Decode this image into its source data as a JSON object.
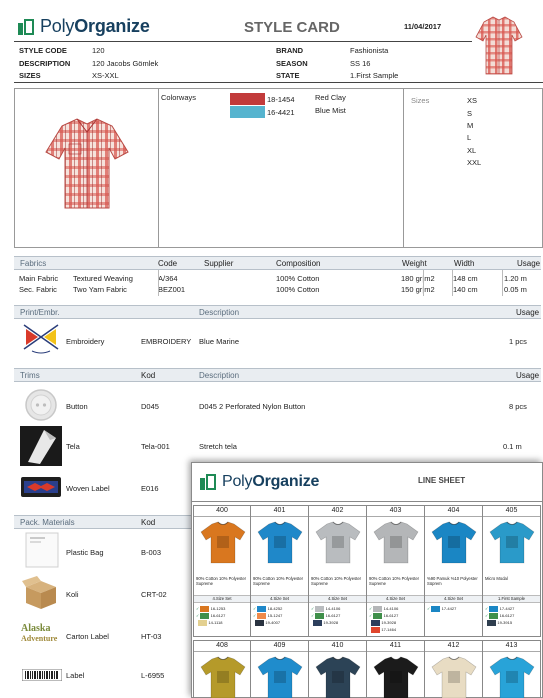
{
  "style_card": {
    "brand_light": "Poly",
    "brand_bold": "Organize",
    "title": "STYLE CARD",
    "date": "11/04/2017",
    "fields_left": [
      {
        "label": "STYLE CODE",
        "value": "120"
      },
      {
        "label": "DESCRIPTION",
        "value": "120 Jacobs Gömlek"
      },
      {
        "label": "SIZES",
        "value": "XS-XXL"
      }
    ],
    "fields_right": [
      {
        "label": "BRAND",
        "value": "Fashionista"
      },
      {
        "label": "SEASON",
        "value": "SS 16"
      },
      {
        "label": "STATE",
        "value": "1.First Sample"
      }
    ],
    "colorways_label": "Colorways",
    "colorways": [
      {
        "code": "18-1454",
        "name": "Red Clay",
        "color": "#c23b3b"
      },
      {
        "code": "16-4421",
        "name": "Blue Mist",
        "color": "#56b4cf"
      }
    ],
    "sizes_label": "Sizes",
    "sizes": [
      "XS",
      "S",
      "M",
      "L",
      "XL",
      "XXL"
    ],
    "fabrics": {
      "headers": [
        "Fabrics",
        "Code",
        "Supplier",
        "Composition",
        "Weight",
        "Width",
        "Usage"
      ],
      "rows": [
        {
          "type": "Main Fabric",
          "name": "Textured Weaving",
          "code": "A/364",
          "supplier": "",
          "composition": "100% Cotton",
          "weight": "180 gr|m2",
          "width": "148 cm",
          "usage": "1.20 m"
        },
        {
          "type": "Sec. Fabric",
          "name": "Two Yarn Fabric",
          "code": "BEZ001",
          "supplier": "",
          "composition": "100% Cotton",
          "weight": "150 gr|m2",
          "width": "140 cm",
          "usage": "0.05 m"
        }
      ]
    },
    "print": {
      "headers": [
        "Print/Embr.",
        "Description",
        "Usage"
      ],
      "rows": [
        {
          "name": "Embroidery",
          "code": "EMBROIDERY",
          "description": "Blue Marine",
          "usage": "1  pcs"
        }
      ]
    },
    "trims": {
      "headers": [
        "Trims",
        "Kod",
        "Description",
        "Usage"
      ],
      "rows": [
        {
          "name": "Button",
          "code": "D045",
          "description": "D045 2 Perforated Nylon Button",
          "usage": "8  pcs"
        },
        {
          "name": "Tela",
          "code": "Tela-001",
          "description": "Stretch tela",
          "usage": "0.1  m"
        },
        {
          "name": "Woven Label",
          "code": "E016",
          "description": "",
          "usage": ""
        }
      ]
    },
    "pack": {
      "headers": [
        "Pack. Materials",
        "Kod"
      ],
      "rows": [
        {
          "name": "Plastic Bag",
          "code": "B-003"
        },
        {
          "name": "Koli",
          "code": "CRT-02"
        },
        {
          "name": "Carton Label",
          "code": "HT-03"
        },
        {
          "name": "Label",
          "code": "L-6955"
        }
      ],
      "carton_label_art": "Alaska",
      "carton_label_art2": "Adventure"
    }
  },
  "line_sheet": {
    "brand_light": "Poly",
    "brand_bold": "Organize",
    "title": "LINE SHEET",
    "items": [
      {
        "code": "400",
        "color": "#d9771f",
        "desc": "90% Cotton 10% Polyester Supreme",
        "set": "4.Size Set",
        "swatches": [
          {
            "code": "16-1253",
            "color": "#d9771f"
          },
          {
            "code": "16-6127",
            "color": "#3f8f4a"
          },
          {
            "code": "14-1118",
            "color": "#e3d090"
          }
        ]
      },
      {
        "code": "401",
        "color": "#1f88c9",
        "desc": "90% Cotton 10% Polyester Supreme",
        "set": "4.Size Set",
        "swatches": [
          {
            "code": "18-4252",
            "color": "#1f88c9"
          },
          {
            "code": "15-1247",
            "color": "#ef8a4a"
          },
          {
            "code": "19-4007",
            "color": "#2a3340"
          }
        ]
      },
      {
        "code": "402",
        "color": "#b9bcbf",
        "desc": "90% Cotton 10% Polyester Supreme",
        "set": "4.Size Set",
        "swatches": [
          {
            "code": "14-4106",
            "color": "#b9bcbf"
          },
          {
            "code": "16-6127",
            "color": "#3f8f4a"
          },
          {
            "code": "19-3928",
            "color": "#2c3e5c"
          }
        ]
      },
      {
        "code": "403",
        "color": "#b4b6b8",
        "desc": "90% Cotton 10% Polyester Supreme",
        "set": "4.Size Set",
        "swatches": [
          {
            "code": "14-4106",
            "color": "#b4b6b8"
          },
          {
            "code": "16-6127",
            "color": "#3f8f4a"
          },
          {
            "code": "19-3928",
            "color": "#2c3e5c"
          },
          {
            "code": "17-1464",
            "color": "#e0452c"
          }
        ]
      },
      {
        "code": "404",
        "color": "#1a86c4",
        "desc": "%90 Pamuk %10 Polyester Süprem",
        "set": "4.Size Set",
        "swatches": [
          {
            "code": "17-4427",
            "color": "#1a86c4"
          }
        ]
      },
      {
        "code": "405",
        "color": "#2a9ac9",
        "desc": "Micro Modal",
        "set": "1.First Sample",
        "swatches": [
          {
            "code": "17-4427",
            "color": "#1a86c4"
          },
          {
            "code": "16-6127",
            "color": "#3f8f4a"
          },
          {
            "code": "19-3915",
            "color": "#2f3e4f"
          }
        ]
      }
    ],
    "items2": [
      {
        "code": "408",
        "color": "#b59a2a"
      },
      {
        "code": "409",
        "color": "#1f8ccc"
      },
      {
        "code": "410",
        "color": "#2c4356"
      },
      {
        "code": "411",
        "color": "#1b1b1b"
      },
      {
        "code": "412",
        "color": "#e8dcc3"
      },
      {
        "code": "413",
        "color": "#28a3d8"
      }
    ]
  }
}
